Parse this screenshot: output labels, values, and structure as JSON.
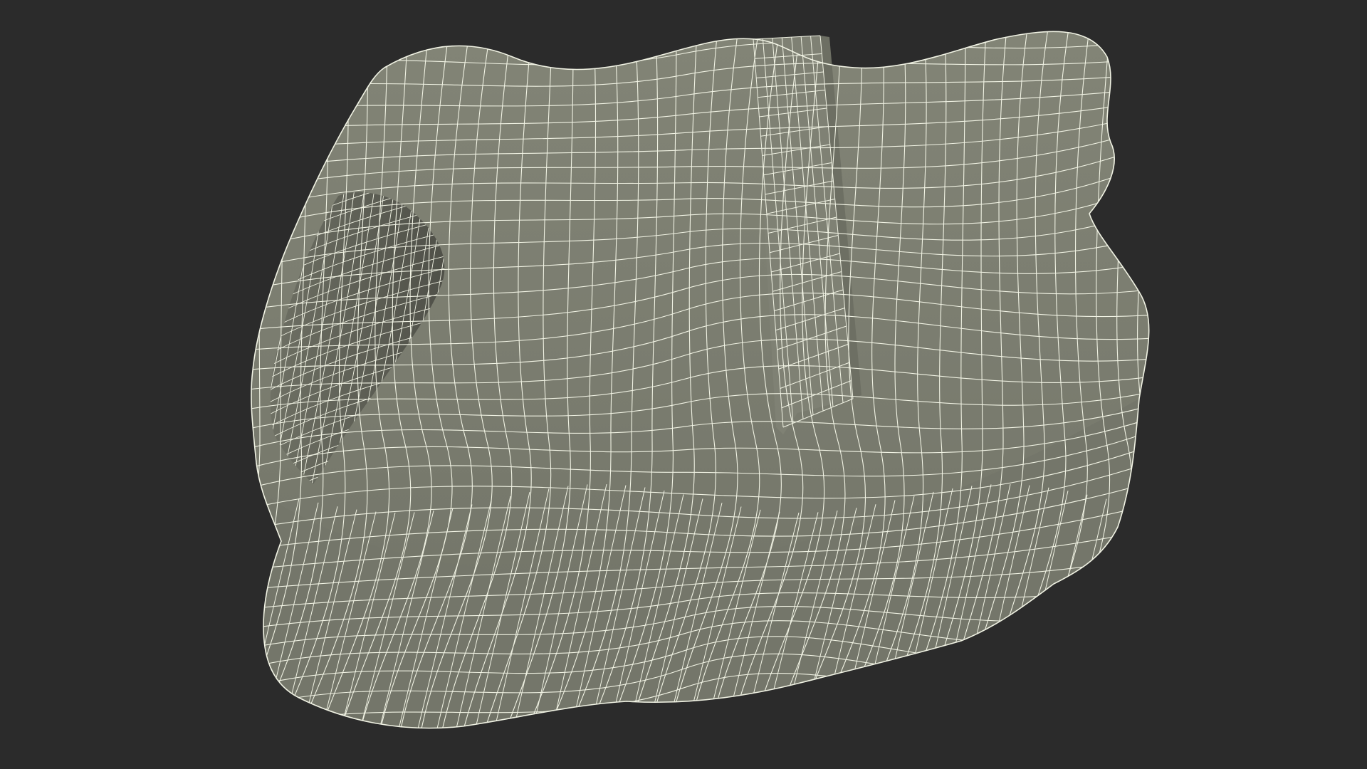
{
  "scene": {
    "background_color": "#2b2b2b",
    "surface_color": "#7b7d70",
    "surface_shadow_color": "#6a6c60",
    "surface_highlight_color": "#8a8c7e",
    "wire_color": "#f1f3e4",
    "inner_cavity_color": "#5a5b52",
    "object": "wireframe-3d-mesh"
  }
}
